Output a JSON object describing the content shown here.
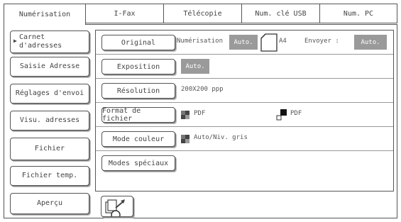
{
  "tabs": [
    {
      "label": "Numérisation",
      "active": true
    },
    {
      "label": "I-Fax",
      "active": false
    },
    {
      "label": "Télécopie",
      "active": false
    },
    {
      "label": "Num. clé USB",
      "active": false
    },
    {
      "label": "Num. PC",
      "active": false
    }
  ],
  "sidebar": {
    "carnet_line1": "Carnet",
    "carnet_line2": "d'adresses",
    "saisie": "Saisie Adresse",
    "reglages": "Réglages d'envoi",
    "visu": "Visu. adresses",
    "fichier": "Fichier",
    "fichier_temp": "Fichier temp.",
    "apercu": "Aperçu"
  },
  "settings": {
    "original": {
      "button": "Original",
      "scan_label": "Numérisation",
      "scan_value": "Auto.",
      "paper": "A4",
      "send_label": "Envoyer :",
      "send_value": "Auto."
    },
    "exposition": {
      "button": "Exposition",
      "value": "Auto."
    },
    "resolution": {
      "button": "Résolution",
      "value": "200X200 ppp"
    },
    "format": {
      "button": "Format de fichier",
      "value1": "PDF",
      "value2": "PDF"
    },
    "couleur": {
      "button": "Mode couleur",
      "value": "Auto/Niv. gris"
    },
    "speciaux": {
      "button": "Modes spéciaux"
    }
  },
  "colors": {
    "badge": "#9a9a9a",
    "border": "#555555"
  }
}
